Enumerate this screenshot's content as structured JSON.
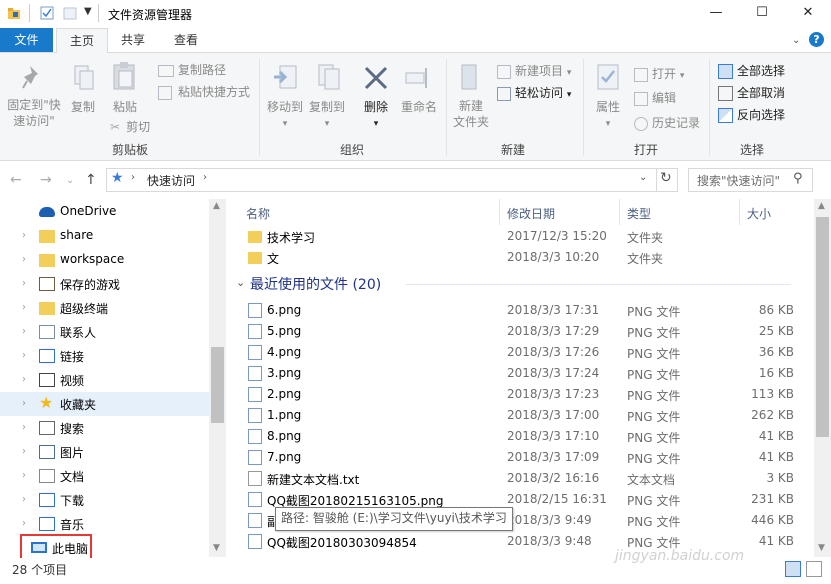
{
  "window": {
    "title": "文件资源管理器",
    "minimize": "—",
    "maximize": "☐",
    "close": "✕"
  },
  "ribbon_tabs": [
    "文件",
    "主页",
    "共享",
    "查看"
  ],
  "ribbon": {
    "clipboard": {
      "pin": "固定到\"快",
      "pin2": "速访问\"",
      "copy": "复制",
      "paste": "粘贴",
      "copy_path": "复制路径",
      "paste_shortcut": "粘贴快捷方式",
      "cut": "剪切",
      "group": "剪贴板"
    },
    "organize": {
      "move_to": "移动到",
      "copy_to": "复制到",
      "delete": "删除",
      "rename": "重命名",
      "group": "组织"
    },
    "new": {
      "new_folder": "新建",
      "new_folder2": "文件夹",
      "new_item": "新建项目",
      "easy_access": "轻松访问",
      "group": "新建"
    },
    "open": {
      "properties": "属性",
      "open": "打开",
      "edit": "编辑",
      "history": "历史记录",
      "group": "打开"
    },
    "select": {
      "select_all": "全部选择",
      "select_none": "全部取消",
      "invert": "反向选择",
      "group": "选择"
    }
  },
  "address": {
    "breadcrumb": "快速访问",
    "search_placeholder": "搜索\"快速访问\""
  },
  "nav_items": [
    {
      "label": "OneDrive",
      "icon": "cloud-icon"
    },
    {
      "label": "share",
      "icon": "folder-icon"
    },
    {
      "label": "workspace",
      "icon": "folder-icon"
    },
    {
      "label": "保存的游戏",
      "icon": "game-icon"
    },
    {
      "label": "超级终端",
      "icon": "folder-icon"
    },
    {
      "label": "联系人",
      "icon": "contacts-icon"
    },
    {
      "label": "链接",
      "icon": "link-icon"
    },
    {
      "label": "视频",
      "icon": "video-icon"
    },
    {
      "label": "收藏夹",
      "icon": "star-icon"
    },
    {
      "label": "搜索",
      "icon": "search-icon"
    },
    {
      "label": "图片",
      "icon": "pictures-icon"
    },
    {
      "label": "文档",
      "icon": "document-icon"
    },
    {
      "label": "下载",
      "icon": "download-icon"
    },
    {
      "label": "音乐",
      "icon": "music-icon"
    },
    {
      "label": "此电脑",
      "icon": "computer-icon"
    }
  ],
  "columns": {
    "name": "名称",
    "date": "修改日期",
    "type": "类型",
    "size": "大小"
  },
  "folders": [
    {
      "name": "技术学习",
      "date": "2017/12/3 15:20",
      "type": "文件夹",
      "size": ""
    },
    {
      "name": "文",
      "date": "2018/3/3 10:20",
      "type": "文件夹",
      "size": ""
    }
  ],
  "recent_group": "最近使用的文件 (20)",
  "files": [
    {
      "name": "6.png",
      "date": "2018/3/3 17:31",
      "type": "PNG 文件",
      "size": "86 KB",
      "icon": "png"
    },
    {
      "name": "5.png",
      "date": "2018/3/3 17:29",
      "type": "PNG 文件",
      "size": "25 KB",
      "icon": "png"
    },
    {
      "name": "4.png",
      "date": "2018/3/3 17:26",
      "type": "PNG 文件",
      "size": "36 KB",
      "icon": "png"
    },
    {
      "name": "3.png",
      "date": "2018/3/3 17:24",
      "type": "PNG 文件",
      "size": "16 KB",
      "icon": "png"
    },
    {
      "name": "2.png",
      "date": "2018/3/3 17:23",
      "type": "PNG 文件",
      "size": "113 KB",
      "icon": "png"
    },
    {
      "name": "1.png",
      "date": "2018/3/3 17:00",
      "type": "PNG 文件",
      "size": "262 KB",
      "icon": "png"
    },
    {
      "name": "8.png",
      "date": "2018/3/3 17:10",
      "type": "PNG 文件",
      "size": "41 KB",
      "icon": "png"
    },
    {
      "name": "7.png",
      "date": "2018/3/3 17:09",
      "type": "PNG 文件",
      "size": "41 KB",
      "icon": "png"
    },
    {
      "name": "新建文本文档.txt",
      "date": "2018/3/2 16:16",
      "type": "文本文档",
      "size": "3 KB",
      "icon": "txt"
    },
    {
      "name": "QQ截图20180215163105.png",
      "date": "2018/2/15 16:31",
      "type": "PNG 文件",
      "size": "231 KB",
      "icon": "png"
    },
    {
      "name": "副...png",
      "date": "2018/3/3 9:49",
      "type": "PNG 文件",
      "size": "446 KB",
      "icon": "png"
    },
    {
      "name": "QQ截图20180303094854",
      "date": "2018/3/3 9:48",
      "type": "PNG 文件",
      "size": "41 KB",
      "icon": "png"
    }
  ],
  "tooltip": "路径: 智骏舱 (E:)\\学习文件\\yuyi\\技术学习",
  "status": {
    "count": "28 个项目"
  },
  "watermark": "jingyan.baidu.com"
}
